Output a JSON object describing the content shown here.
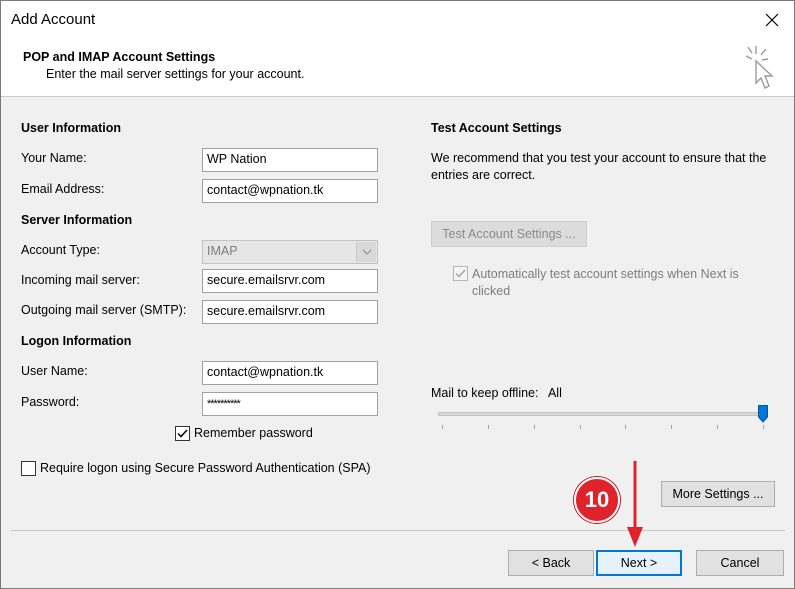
{
  "window": {
    "title": "Add Account"
  },
  "header": {
    "title": "POP and IMAP Account Settings",
    "subtitle": "Enter the mail server settings for your account."
  },
  "user_info": {
    "section": "User Information",
    "name_label": "Your Name:",
    "name_value": "WP Nation",
    "email_label": "Email Address:",
    "email_value": "contact@wpnation.tk"
  },
  "server_info": {
    "section": "Server Information",
    "account_type_label": "Account Type:",
    "account_type_value": "IMAP",
    "incoming_label": "Incoming mail server:",
    "incoming_value": "secure.emailsrvr.com",
    "outgoing_label": "Outgoing mail server (SMTP):",
    "outgoing_value": "secure.emailsrvr.com"
  },
  "logon_info": {
    "section": "Logon Information",
    "username_label": "User Name:",
    "username_value": "contact@wpnation.tk",
    "password_label": "Password:",
    "password_value": "**********",
    "remember_label": "Remember password",
    "remember_checked": true,
    "spa_label": "Require logon using Secure Password Authentication (SPA)",
    "spa_checked": false
  },
  "test_settings": {
    "section": "Test Account Settings",
    "description": "We recommend that you test your account to ensure that the entries are correct.",
    "button_label": "Test Account Settings ...",
    "auto_test_label": "Automatically test account settings when Next is clicked",
    "auto_test_checked": true
  },
  "offline": {
    "label": "Mail to keep offline:",
    "value": "All",
    "level_percent": 100
  },
  "more_settings_label": "More Settings ...",
  "footer": {
    "back_label": "< Back",
    "next_label": "Next >",
    "cancel_label": "Cancel"
  },
  "annotation": {
    "step_number": "10",
    "color": "#e0232b"
  }
}
